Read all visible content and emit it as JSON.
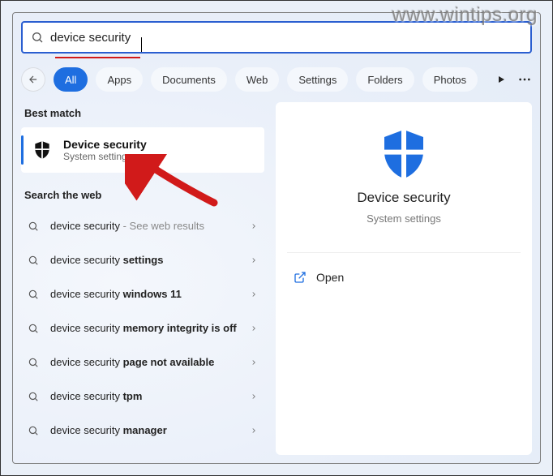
{
  "watermark": "www.wintips.org",
  "search": {
    "value": "device security",
    "placeholder": ""
  },
  "tabs": {
    "all": "All",
    "apps": "Apps",
    "documents": "Documents",
    "web": "Web",
    "settings": "Settings",
    "folders": "Folders",
    "photos": "Photos"
  },
  "sections": {
    "best_match": "Best match",
    "search_web": "Search the web"
  },
  "best_match": {
    "title": "Device security",
    "subtitle": "System settings"
  },
  "web_results": [
    {
      "prefix": "device security",
      "bold": "",
      "suffix": " - See web results"
    },
    {
      "prefix": "device security ",
      "bold": "settings",
      "suffix": ""
    },
    {
      "prefix": "device security ",
      "bold": "windows 11",
      "suffix": ""
    },
    {
      "prefix": "device security ",
      "bold": "memory integrity is off",
      "suffix": ""
    },
    {
      "prefix": "device security ",
      "bold": "page not available",
      "suffix": ""
    },
    {
      "prefix": "device security ",
      "bold": "tpm",
      "suffix": ""
    },
    {
      "prefix": "device security ",
      "bold": "manager",
      "suffix": ""
    }
  ],
  "detail": {
    "title": "Device security",
    "subtitle": "System settings",
    "open": "Open"
  },
  "colors": {
    "accent": "#1e6ee0",
    "annotation": "#d11a1a"
  }
}
